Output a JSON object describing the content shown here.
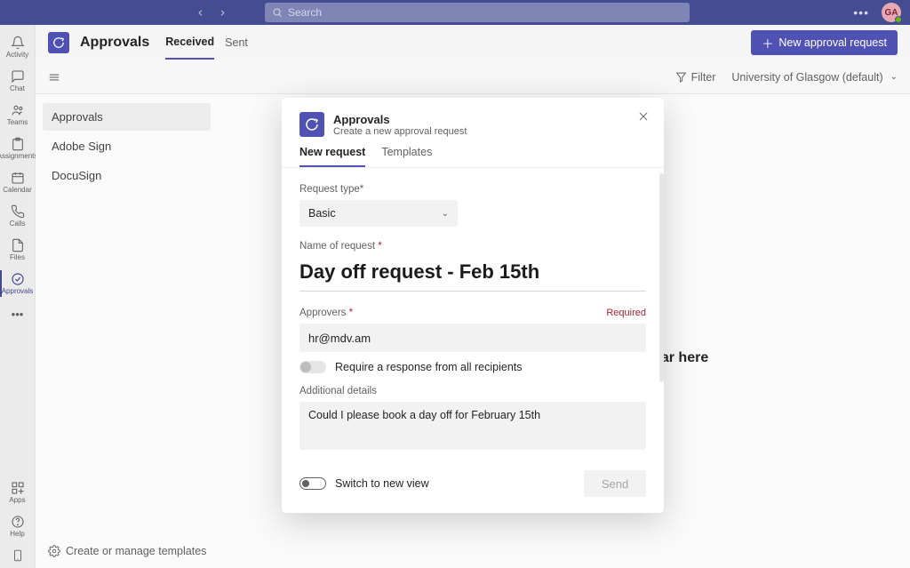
{
  "titlebar": {
    "search_placeholder": "Search",
    "avatar_initials": "GA"
  },
  "rail": {
    "items": [
      {
        "label": "Activity",
        "icon": "bell"
      },
      {
        "label": "Chat",
        "icon": "chat"
      },
      {
        "label": "Teams",
        "icon": "teams"
      },
      {
        "label": "Assignments",
        "icon": "assignments"
      },
      {
        "label": "Calendar",
        "icon": "calendar"
      },
      {
        "label": "Calls",
        "icon": "calls"
      },
      {
        "label": "Files",
        "icon": "files"
      },
      {
        "label": "Approvals",
        "icon": "approvals"
      }
    ],
    "bottom": [
      {
        "label": "Apps",
        "icon": "apps"
      },
      {
        "label": "Help",
        "icon": "help"
      },
      {
        "label": "",
        "icon": "phone"
      }
    ]
  },
  "page": {
    "title": "Approvals",
    "tabs": [
      "Received",
      "Sent"
    ],
    "new_button": "New approval request",
    "filter_label": "Filter",
    "scope_label": "University of Glasgow (default)"
  },
  "sidebar": {
    "items": [
      "Approvals",
      "Adobe Sign",
      "DocuSign"
    ]
  },
  "main": {
    "empty_text": "Any approvals sent to you will appear here"
  },
  "footer": {
    "manage_templates": "Create or manage templates"
  },
  "modal": {
    "title": "Approvals",
    "subtitle": "Create a new approval request",
    "tabs": [
      "New request",
      "Templates"
    ],
    "request_type_label": "Request type*",
    "request_type_value": "Basic",
    "name_label": "Name of request",
    "name_value": "Day off request - Feb 15th",
    "approvers_label": "Approvers",
    "required_tag": "Required",
    "approvers_value": "hr@mdv.am",
    "require_all_label": "Require a response from all recipients",
    "details_label": "Additional details",
    "details_value": "Could I please book a day off for February 15th",
    "switch_label": "Switch to new view",
    "send_label": "Send"
  }
}
